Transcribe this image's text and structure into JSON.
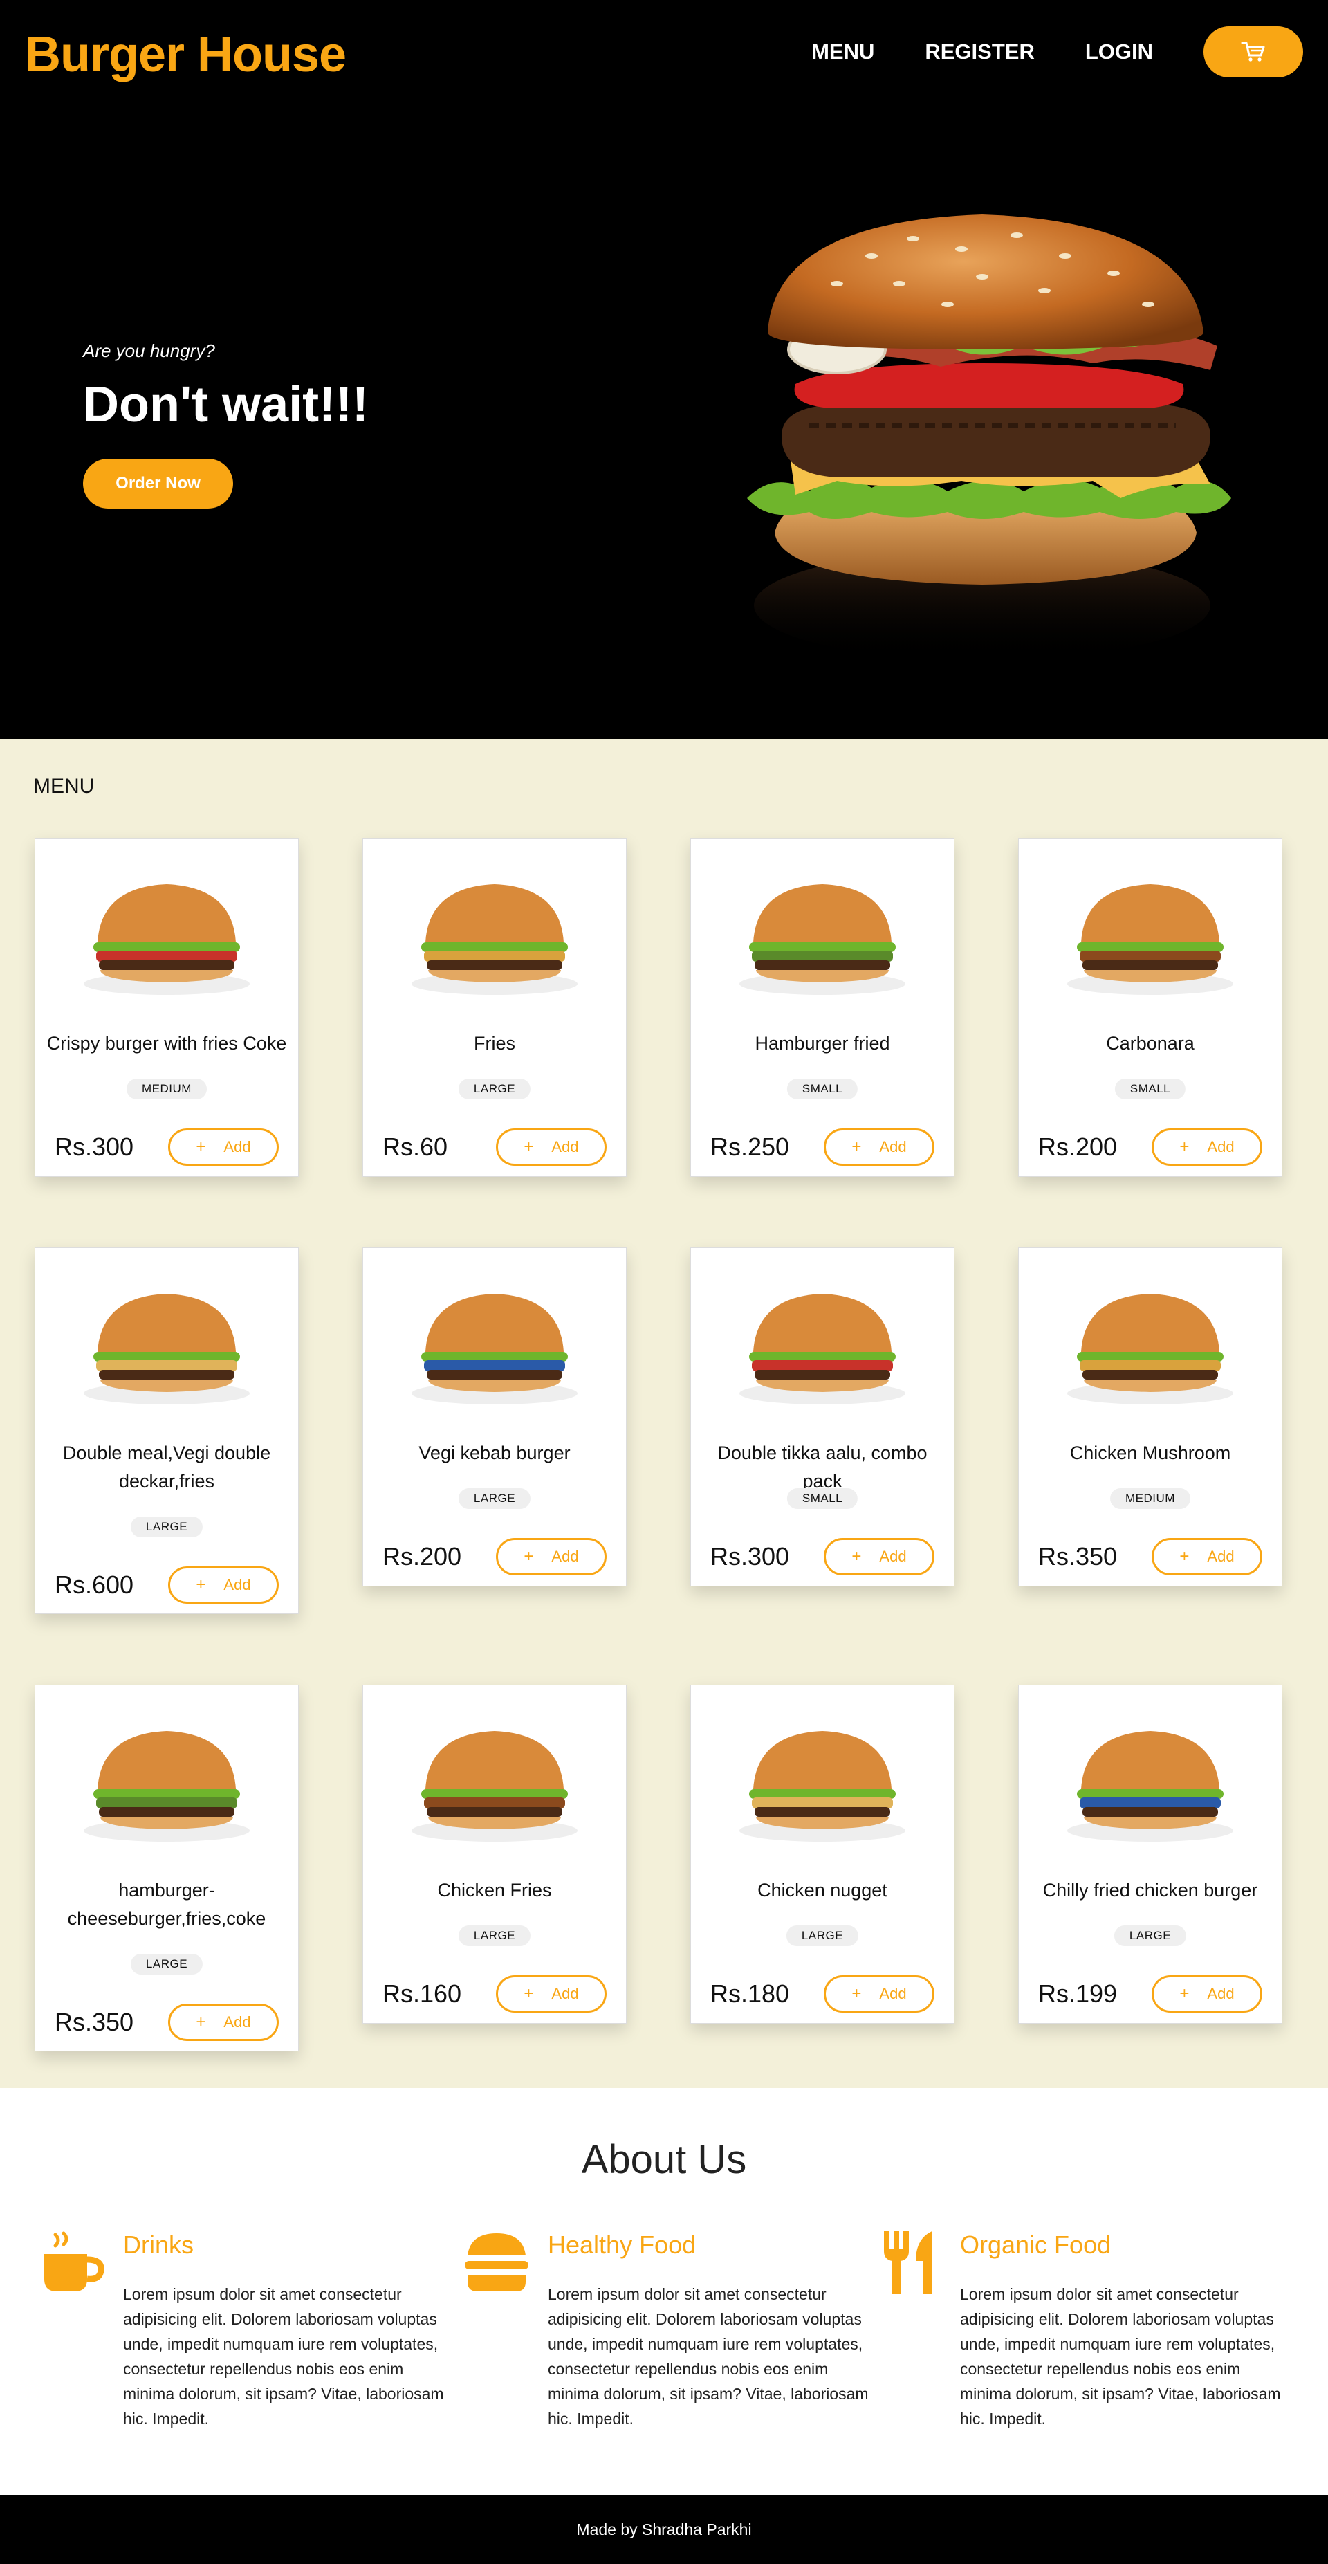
{
  "brand": "Burger House",
  "nav": {
    "menu": "MENU",
    "register": "REGISTER",
    "login": "LOGIN",
    "cart_icon": "cart-icon"
  },
  "hero": {
    "subtitle": "Are you hungry?",
    "title": "Don't wait!!!",
    "cta": "Order Now"
  },
  "menu": {
    "heading": "MENU",
    "add_label": "Add",
    "items": [
      {
        "name": "Crispy burger with fries Coke",
        "size": "MEDIUM",
        "price": "Rs.300"
      },
      {
        "name": "Fries",
        "size": "LARGE",
        "price": "Rs.60"
      },
      {
        "name": "Hamburger fried",
        "size": "SMALL",
        "price": "Rs.250"
      },
      {
        "name": "Carbonara",
        "size": "SMALL",
        "price": "Rs.200"
      },
      {
        "name": "Double meal,Vegi double deckar,fries",
        "size": "LARGE",
        "price": "Rs.600"
      },
      {
        "name": "Vegi kebab burger",
        "size": "LARGE",
        "price": "Rs.200"
      },
      {
        "name": "Double tikka aalu, combo pack",
        "size": "SMALL",
        "price": "Rs.300"
      },
      {
        "name": "Chicken Mushroom",
        "size": "MEDIUM",
        "price": "Rs.350"
      },
      {
        "name": "hamburger-cheeseburger,fries,coke",
        "size": "LARGE",
        "price": "Rs.350"
      },
      {
        "name": "Chicken Fries",
        "size": "LARGE",
        "price": "Rs.160"
      },
      {
        "name": "Chicken nugget",
        "size": "LARGE",
        "price": "Rs.180"
      },
      {
        "name": "Chilly fried chicken burger",
        "size": "LARGE",
        "price": "Rs.199"
      }
    ]
  },
  "about": {
    "title": "About Us",
    "features": [
      {
        "title": "Drinks",
        "icon": "mug-icon",
        "body": "Lorem ipsum dolor sit amet consectetur adipisicing elit. Dolorem laboriosam voluptas unde, impedit numquam iure rem voluptates, consectetur repellendus nobis eos enim minima dolorum, sit ipsam? Vitae, laboriosam hic. Impedit."
      },
      {
        "title": "Healthy Food",
        "icon": "burger-icon",
        "body": "Lorem ipsum dolor sit amet consectetur adipisicing elit. Dolorem laboriosam voluptas unde, impedit numquam iure rem voluptates, consectetur repellendus nobis eos enim minima dolorum, sit ipsam? Vitae, laboriosam hic. Impedit."
      },
      {
        "title": "Organic Food",
        "icon": "utensils-icon",
        "body": "Lorem ipsum dolor sit amet consectetur adipisicing elit. Dolorem laboriosam voluptas unde, impedit numquam iure rem voluptates, consectetur repellendus nobis eos enim minima dolorum, sit ipsam? Vitae, laboriosam hic. Impedit."
      }
    ]
  },
  "footer": "Made by Shradha Parkhi",
  "colors": {
    "accent": "#f9a614",
    "menu_bg": "#f3f0d9",
    "dark": "#000000"
  }
}
